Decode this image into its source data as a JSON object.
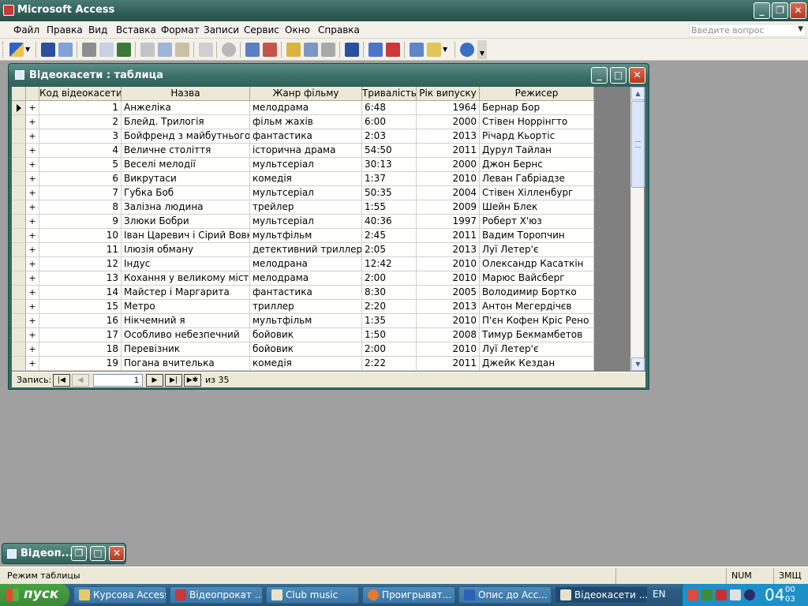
{
  "app": {
    "title": "Microsoft Access"
  },
  "menu": {
    "items": [
      "Файл",
      "Правка",
      "Вид",
      "Вставка",
      "Формат",
      "Записи",
      "Сервис",
      "Окно",
      "Справка"
    ],
    "ask_placeholder": "Введите вопрос"
  },
  "window": {
    "title": "Відеокасети : таблица"
  },
  "table": {
    "columns": [
      "Код відеокасети",
      "Назва",
      "Жанр фільму",
      "Тривалість",
      "Рік випуску",
      "Режисер"
    ],
    "rows": [
      [
        "1",
        "Анжеліка",
        "мелодрама",
        "6:48",
        "1964",
        "Бернар Бор"
      ],
      [
        "2",
        "Блейд. Трилогія",
        "фільм жахів",
        "6:00",
        "2000",
        "Стівен Норрінгто"
      ],
      [
        "3",
        "Бойфренд з майбутнього",
        "фантастика",
        "2:03",
        "2013",
        "Річард Кьортіс"
      ],
      [
        "4",
        "Величне століття",
        "історична драма",
        "54:50",
        "2011",
        "Дурул Тайлан"
      ],
      [
        "5",
        "Веселі мелодії",
        "мультсеріал",
        "30:13",
        "2000",
        "Джон Бернс"
      ],
      [
        "6",
        "Викрутаси",
        "комедія",
        "1:37",
        "2010",
        "Леван Габріадзе"
      ],
      [
        "7",
        "Губка Боб",
        "мультсеріал",
        "50:35",
        "2004",
        "Стівен Хілленбург"
      ],
      [
        "8",
        "Залізна людина",
        "трейлер",
        "1:55",
        "2009",
        "Шейн Блек"
      ],
      [
        "9",
        "Злюки Бобри",
        "мультсеріал",
        "40:36",
        "1997",
        "Роберт Х'юз"
      ],
      [
        "10",
        "Іван Царевич і Сірий Вовк",
        "мультфільм",
        "2:45",
        "2011",
        "Вадим Торопчин"
      ],
      [
        "11",
        "Ілюзія обману",
        "детективний триллер",
        "2:05",
        "2013",
        "Луї Летер'є"
      ],
      [
        "12",
        "Індус",
        "мелодрана",
        "12:42",
        "2010",
        "Олександр Касаткін"
      ],
      [
        "13",
        "Кохання у великому місті",
        "мелодрама",
        "2:00",
        "2010",
        "Марюс Вайсберг"
      ],
      [
        "14",
        "Майстер і Маргарита",
        "фантастика",
        "8:30",
        "2005",
        "Володимир Бортко"
      ],
      [
        "15",
        "Метро",
        "триллер",
        "2:20",
        "2013",
        "Антон Мегердічєв"
      ],
      [
        "16",
        "Нікчемний я",
        "мультфільм",
        "1:35",
        "2010",
        "П'єн Кофен Кріс Рено"
      ],
      [
        "17",
        "Особливо небезпечний",
        "бойовик",
        "1:50",
        "2008",
        "Тимур Бекмамбетов"
      ],
      [
        "18",
        "Перевізник",
        "бойовик",
        "2:00",
        "2010",
        "Луї Летер'є"
      ],
      [
        "19",
        "Погана вчителька",
        "комедія",
        "2:22",
        "2011",
        "Джейк Кездан"
      ]
    ],
    "expand_glyph": "+"
  },
  "navigator": {
    "label": "Запись:",
    "current": "1",
    "of_text": "из  35"
  },
  "minimized": {
    "title": "Відеоп..."
  },
  "status": {
    "left": "Режим таблицы",
    "num": "NUM",
    "ext": "ЗМЩ"
  },
  "taskbar": {
    "start": "пуск",
    "tasks": [
      "Курсова Access",
      "Відеопрокат ...",
      "Club music",
      "Проигрыват...",
      "Опис до Acc...",
      "Відеокасети ..."
    ],
    "lang": "EN",
    "clock_hour": "04",
    "clock_min": "00",
    "clock_sec": "03"
  },
  "colors": {
    "title_teal": "#2f625b",
    "taskbar_blue": "#2b5c82",
    "start_green": "#3b8a35"
  }
}
